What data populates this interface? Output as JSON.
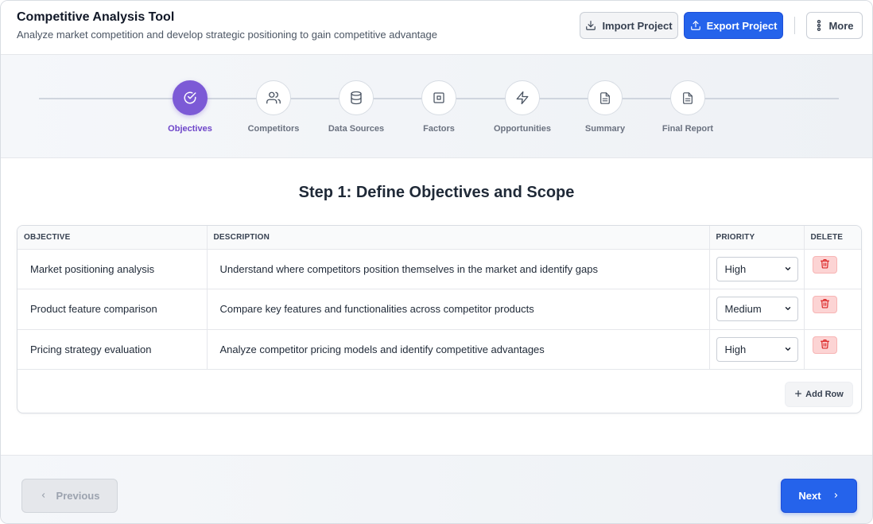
{
  "header": {
    "title": "Competitive Analysis Tool",
    "subtitle": "Analyze market competition and develop strategic positioning to gain competitive advantage",
    "import_label": "Import Project",
    "export_label": "Export Project",
    "more_label": "More"
  },
  "stepper": {
    "steps": [
      {
        "label": "Objectives",
        "icon": "check-circle-icon",
        "active": true
      },
      {
        "label": "Competitors",
        "icon": "users-icon",
        "active": false
      },
      {
        "label": "Data Sources",
        "icon": "database-icon",
        "active": false
      },
      {
        "label": "Factors",
        "icon": "square-target-icon",
        "active": false
      },
      {
        "label": "Opportunities",
        "icon": "lightning-icon",
        "active": false
      },
      {
        "label": "Summary",
        "icon": "document-icon",
        "active": false
      },
      {
        "label": "Final Report",
        "icon": "document-icon",
        "active": false
      }
    ]
  },
  "main": {
    "title": "Step 1: Define Objectives and Scope",
    "table": {
      "columns": [
        "OBJECTIVE",
        "DESCRIPTION",
        "PRIORITY",
        "DELETE"
      ],
      "rows": [
        {
          "objective": "Market positioning analysis",
          "description": "Understand where competitors position themselves in the market and identify gaps",
          "priority": "High"
        },
        {
          "objective": "Product feature comparison",
          "description": "Compare key features and functionalities across competitor products",
          "priority": "Medium"
        },
        {
          "objective": "Pricing strategy evaluation",
          "description": "Analyze competitor pricing models and identify competitive advantages",
          "priority": "High"
        }
      ],
      "add_row_label": "Add Row"
    }
  },
  "footer": {
    "previous_label": "Previous",
    "next_label": "Next"
  },
  "colors": {
    "accent": "#2563eb",
    "step_active": "#7c5ad6",
    "delete": "#dc2626"
  }
}
